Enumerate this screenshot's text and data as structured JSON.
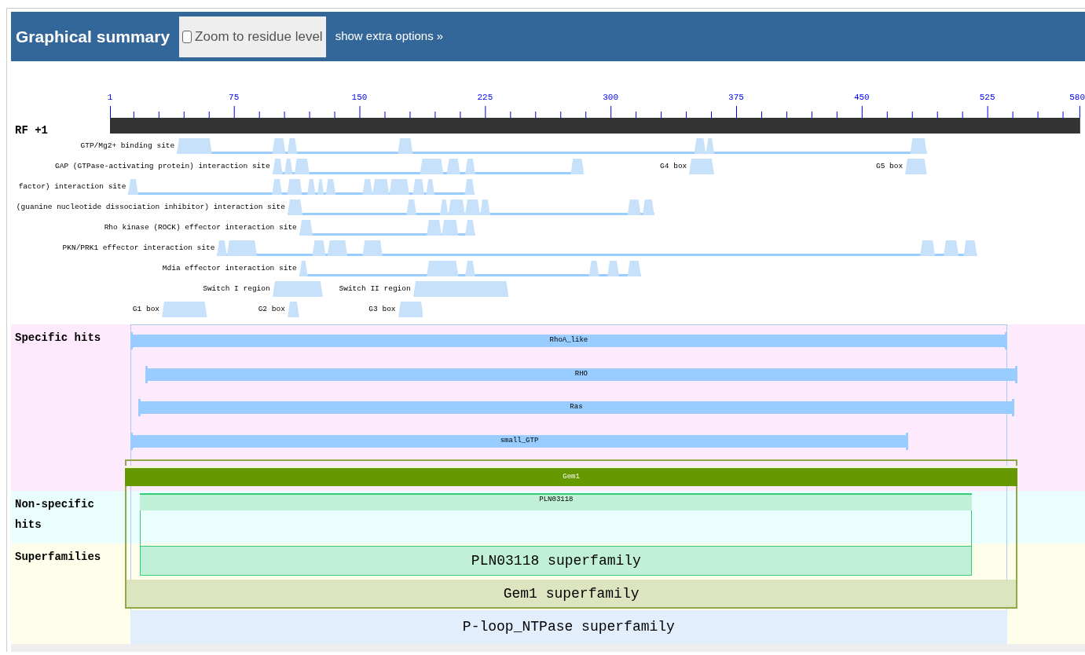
{
  "header": {
    "title": "Graphical summary",
    "zoom_toggle": {
      "label": "Zoom to residue level",
      "checked": false
    },
    "extra_link": "show extra options »"
  },
  "ruler": {
    "ticks": [
      "1",
      "75",
      "150",
      "225",
      "300",
      "375",
      "450",
      "525",
      "580"
    ],
    "frame_label": "RF +1"
  },
  "site_rows": [
    {
      "features": [
        {
          "label": "GTP/Mg2+ binding site"
        }
      ]
    },
    {
      "features": [
        {
          "label": "GAP (GTPase-activating protein) interaction site"
        },
        {
          "label": "G4 box"
        },
        {
          "label": "G5 box"
        }
      ]
    },
    {
      "features": [
        {
          "label": "factor) interaction site"
        }
      ]
    },
    {
      "features": [
        {
          "label": "(guanine nucleotide dissociation inhibitor) interaction site"
        }
      ]
    },
    {
      "features": [
        {
          "label": "Rho kinase (ROCK) effector interaction site"
        }
      ]
    },
    {
      "features": [
        {
          "label": "PKN/PRK1 effector interaction site"
        }
      ]
    },
    {
      "features": [
        {
          "label": "Mdia effector interaction site"
        }
      ]
    },
    {
      "features": [
        {
          "label": "Switch I region"
        },
        {
          "label": "Switch II region"
        }
      ]
    },
    {
      "features": [
        {
          "label": "G1 box"
        },
        {
          "label": "G2 box"
        },
        {
          "label": "G3 box"
        }
      ]
    }
  ],
  "sections": [
    {
      "label": "Specific hits",
      "hits": [
        {
          "label": "RhoA_like",
          "kind": "specific"
        },
        {
          "label": "RHO",
          "kind": "specific"
        },
        {
          "label": "Ras",
          "kind": "specific"
        },
        {
          "label": "small_GTP",
          "kind": "specific"
        },
        {
          "label": "Gem1",
          "kind": "multi"
        }
      ]
    },
    {
      "label": "Non-specific hits",
      "hits": [
        {
          "label": "PLN03118",
          "kind": "nonspecific"
        }
      ]
    },
    {
      "label": "Superfamilies",
      "hits": [
        {
          "label": "PLN03118 superfamily",
          "kind": "superfamily"
        },
        {
          "label": "Gem1 superfamily",
          "kind": "superfamily"
        },
        {
          "label": "P-loop_NTPase superfamily",
          "kind": "superfamily"
        }
      ]
    }
  ]
}
